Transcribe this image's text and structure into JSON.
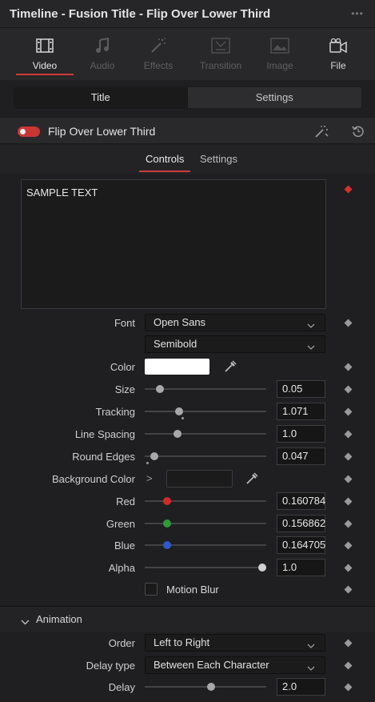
{
  "window": {
    "title": "Timeline - Fusion Title - Flip Over Lower Third",
    "more_label": "•••"
  },
  "tabs": [
    {
      "label": "Video",
      "icon": "film-strip-icon",
      "active": true
    },
    {
      "label": "Audio",
      "icon": "music-note-icon",
      "active": false
    },
    {
      "label": "Effects",
      "icon": "magic-wand-icon",
      "active": false
    },
    {
      "label": "Transition",
      "icon": "transition-icon",
      "active": false
    },
    {
      "label": "Image",
      "icon": "image-icon",
      "active": false
    },
    {
      "label": "File",
      "icon": "file-camera-icon",
      "active": false
    }
  ],
  "segments": {
    "title": "Title",
    "settings": "Settings"
  },
  "effect": {
    "name": "Flip Over Lower Third",
    "enabled": true
  },
  "subtabs": {
    "controls": "Controls",
    "settings": "Settings"
  },
  "text_input": {
    "value": "SAMPLE TEXT"
  },
  "controls": {
    "font": {
      "label": "Font",
      "value": "Open Sans"
    },
    "font_style": {
      "value": "Semibold"
    },
    "color": {
      "label": "Color",
      "value": "#ffffff"
    },
    "size": {
      "label": "Size",
      "value": "0.05"
    },
    "tracking": {
      "label": "Tracking",
      "value": "1.071"
    },
    "line_spacing": {
      "label": "Line Spacing",
      "value": "1.0"
    },
    "round_edges": {
      "label": "Round Edges",
      "value": "0.047"
    },
    "background_color": {
      "label": "Background Color",
      "expander": ">"
    },
    "red": {
      "label": "Red",
      "value": "0.160784"
    },
    "green": {
      "label": "Green",
      "value": "0.156862"
    },
    "blue": {
      "label": "Blue",
      "value": "0.164705"
    },
    "alpha": {
      "label": "Alpha",
      "value": "1.0"
    },
    "motion_blur": {
      "label": "Motion Blur",
      "checked": false
    }
  },
  "animation": {
    "section_label": "Animation",
    "order": {
      "label": "Order",
      "value": "Left to Right"
    },
    "delay_type": {
      "label": "Delay type",
      "value": "Between Each Character"
    },
    "delay": {
      "label": "Delay",
      "value": "2.0"
    }
  },
  "colors": {
    "accent": "#d23a3a",
    "keyframe_active": "#d63030",
    "red_channel": "#cf2a2a",
    "green_channel": "#2f9a38",
    "blue_channel": "#2f58c8"
  }
}
